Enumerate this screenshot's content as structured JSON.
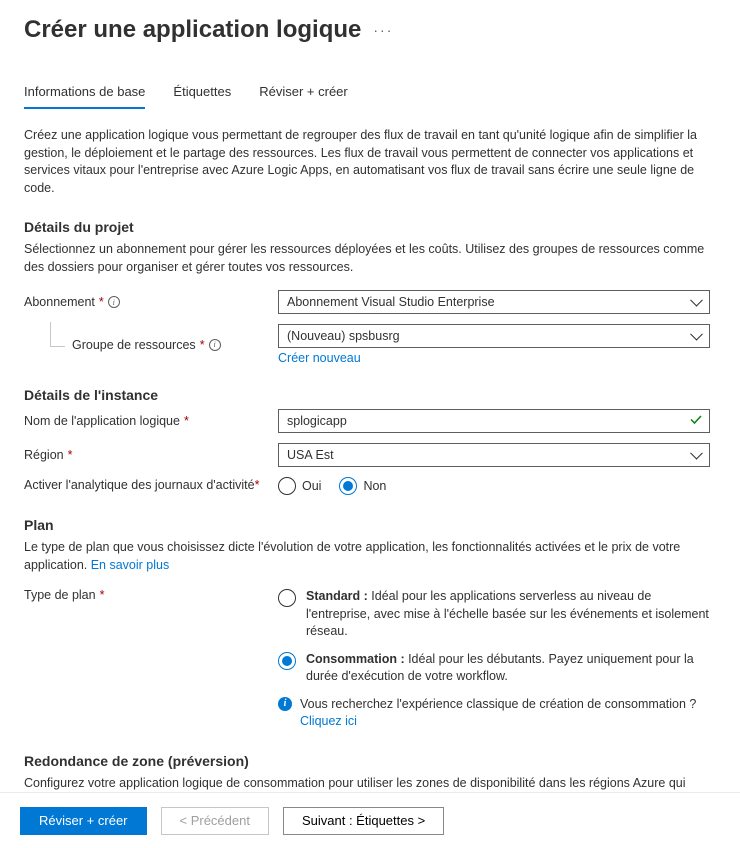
{
  "header": {
    "title": "Créer une application logique"
  },
  "tabs": {
    "basics": "Informations de base",
    "tags": "Étiquettes",
    "review": "Réviser + créer"
  },
  "intro": "Créez une application logique vous permettant de regrouper des flux de travail en tant qu'unité logique afin de simplifier la gestion, le déploiement et le partage des ressources. Les flux de travail vous permettent de connecter vos applications et services vitaux pour l'entreprise avec Azure Logic Apps, en automatisant vos flux de travail sans écrire une seule ligne de code.",
  "project": {
    "title": "Détails du projet",
    "desc": "Sélectionnez un abonnement pour gérer les ressources déployées et les coûts. Utilisez des groupes de ressources comme des dossiers pour organiser et gérer toutes vos ressources.",
    "subscription_label": "Abonnement",
    "subscription_value": "Abonnement Visual Studio Enterprise",
    "rg_label": "Groupe de ressources",
    "rg_value": "(Nouveau) spsbusrg",
    "create_new": "Créer nouveau"
  },
  "instance": {
    "title": "Détails de l'instance",
    "name_label": "Nom de l'application logique",
    "name_value": "splogicapp",
    "region_label": "Région",
    "region_value": "USA Est",
    "la_label": "Activer l'analytique des journaux d'activité",
    "yes": "Oui",
    "no": "Non"
  },
  "plan": {
    "title": "Plan",
    "desc": "Le type de plan que vous choisissez dicte l'évolution de votre application, les fonctionnalités activées et le prix de votre application. ",
    "learn_more": "En savoir plus",
    "type_label": "Type de plan",
    "standard_title": "Standard :",
    "standard_desc": " Idéal pour les applications serverless au niveau de l'entreprise, avec mise à l'échelle basée sur les événements et isolement réseau.",
    "consumption_title": "Consommation :",
    "consumption_desc": " Idéal pour les débutants. Payez uniquement pour la durée d'exécution de votre workflow.",
    "classic_q": "Vous recherchez l'expérience classique de création de consommation ?",
    "click_here": "Cliquez ici"
  },
  "zone": {
    "title": "Redondance de zone (préversion)",
    "desc": "Configurez votre application logique de consommation pour utiliser les zones de disponibilité dans les régions Azure qui"
  },
  "footer": {
    "review": "Réviser + créer",
    "prev": "< Précédent",
    "next": "Suivant : Étiquettes >"
  }
}
